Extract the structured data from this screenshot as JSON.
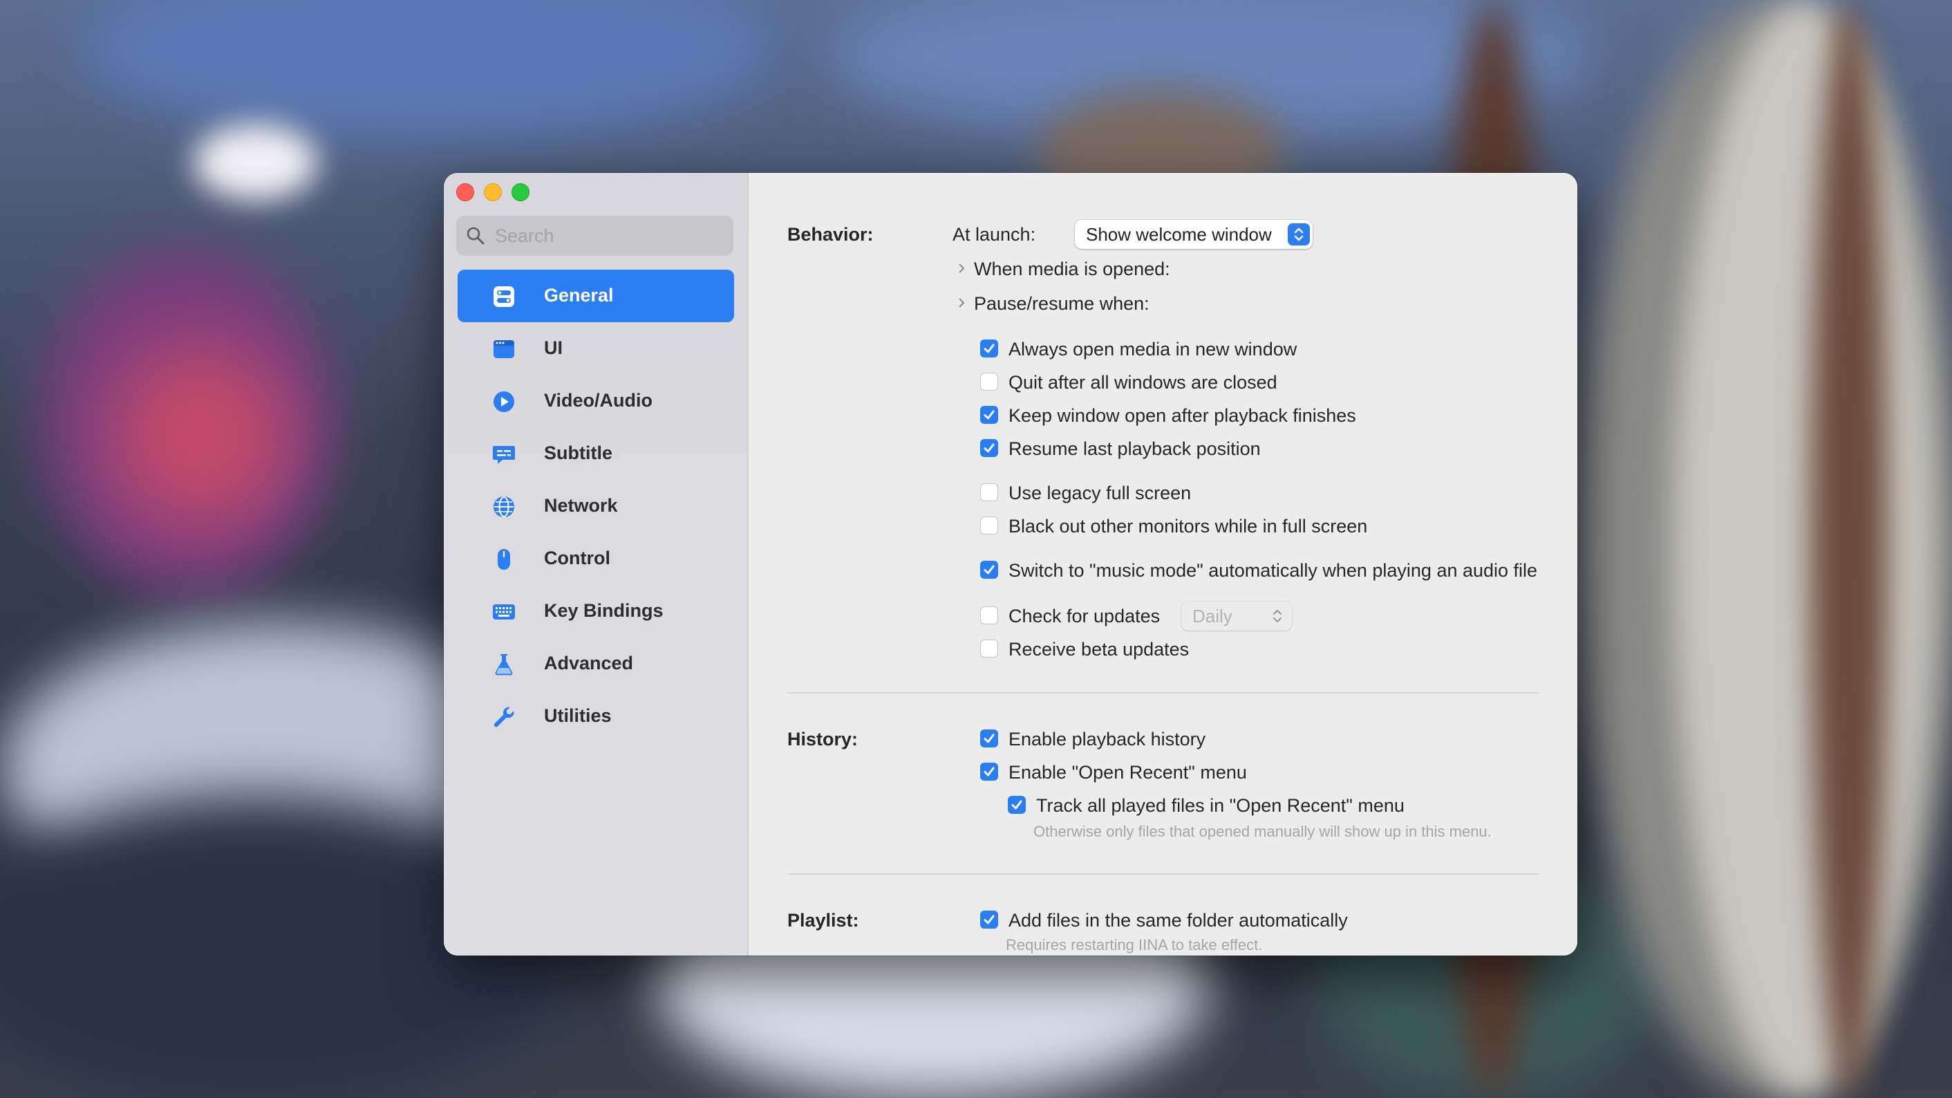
{
  "sidebar": {
    "search_placeholder": "Search",
    "items": [
      {
        "label": "General",
        "icon": "general-icon",
        "active": true
      },
      {
        "label": "UI",
        "icon": "ui-icon"
      },
      {
        "label": "Video/Audio",
        "icon": "play-icon"
      },
      {
        "label": "Subtitle",
        "icon": "subtitle-icon"
      },
      {
        "label": "Network",
        "icon": "globe-icon"
      },
      {
        "label": "Control",
        "icon": "mouse-icon"
      },
      {
        "label": "Key Bindings",
        "icon": "keyboard-icon"
      },
      {
        "label": "Advanced",
        "icon": "flask-icon"
      },
      {
        "label": "Utilities",
        "icon": "wrench-icon"
      }
    ]
  },
  "behavior": {
    "label": "Behavior:",
    "at_launch_label": "At launch:",
    "at_launch_value": "Show welcome window",
    "when_media_opened": "When media is opened:",
    "pause_resume_when": "Pause/resume when:",
    "options": {
      "always_open_new_window": {
        "label": "Always open media in new window",
        "checked": true
      },
      "quit_after_closed": {
        "label": "Quit after all windows are closed",
        "checked": false
      },
      "keep_window_open": {
        "label": "Keep window open after playback finishes",
        "checked": true
      },
      "resume_last_position": {
        "label": "Resume last playback position",
        "checked": true
      },
      "legacy_full_screen": {
        "label": "Use legacy full screen",
        "checked": false
      },
      "black_out_monitors": {
        "label": "Black out other monitors while in full screen",
        "checked": false
      },
      "music_mode": {
        "label": "Switch to \"music mode\" automatically when playing an audio file",
        "checked": true
      },
      "check_updates": {
        "label": "Check for updates",
        "checked": false
      },
      "beta_updates": {
        "label": "Receive beta updates",
        "checked": false
      }
    },
    "update_interval": "Daily"
  },
  "history": {
    "label": "History:",
    "enable_history": {
      "label": "Enable playback history",
      "checked": true
    },
    "enable_open_recent": {
      "label": "Enable \"Open Recent\" menu",
      "checked": true
    },
    "track_all_played": {
      "label": "Track all played files in \"Open Recent\" menu",
      "checked": true
    },
    "track_note": "Otherwise only files that opened manually will show up in this menu."
  },
  "playlist": {
    "label": "Playlist:",
    "add_same_folder": {
      "label": "Add files in the same folder automatically",
      "checked": true
    },
    "restart_note": "Requires restarting IINA to take effect."
  },
  "colors": {
    "accent": "#2a7ef2",
    "close": "#fe5f57",
    "minimize": "#febc2e",
    "zoom": "#28c840"
  }
}
